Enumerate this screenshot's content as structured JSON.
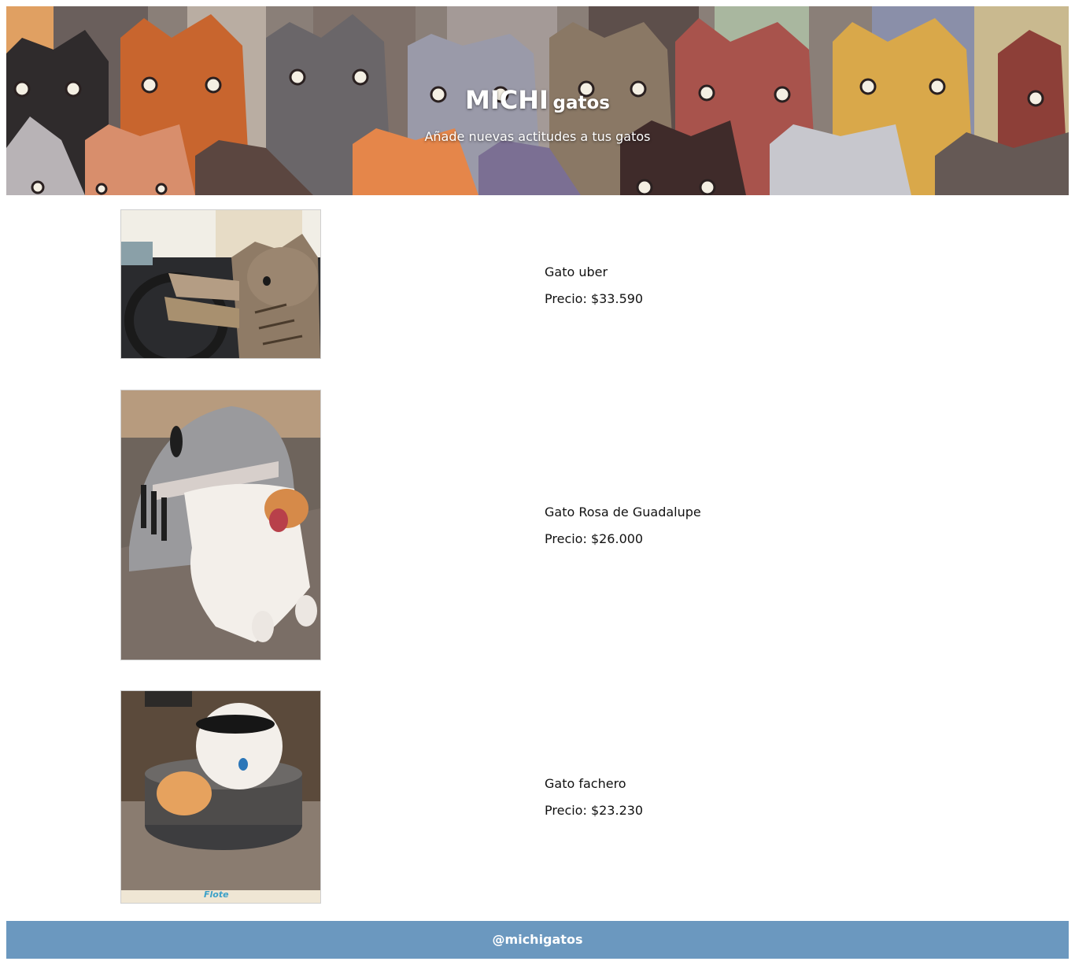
{
  "header": {
    "title_main": "MICHI",
    "title_sub": "gatos",
    "subtitle": "Añade nuevas actitudes a tus gatos"
  },
  "products": [
    {
      "name": "Gato uber",
      "price": "Precio: $33.590",
      "image": "cat-driving-car-photo"
    },
    {
      "name": "Gato Rosa de Guadalupe",
      "price": "Precio: $26.000",
      "image": "cat-in-shark-bed-photo"
    },
    {
      "name": "Gato fachero",
      "price": "Precio: $23.230",
      "image": "cat-with-sunglasses-in-pot-photo",
      "watermark": "Flote"
    }
  ],
  "footer": {
    "handle": "@michigatos"
  },
  "colors": {
    "footer_bg": "#6b98bf",
    "header_text": "#ffffff"
  }
}
